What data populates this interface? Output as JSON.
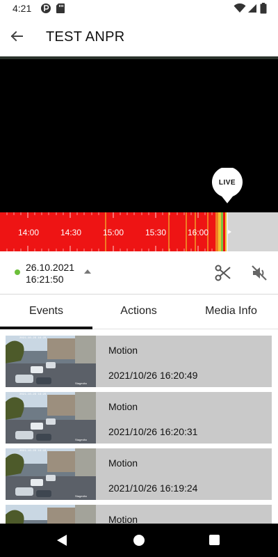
{
  "status_bar": {
    "time": "4:21",
    "left_icons": [
      "p-badge-icon",
      "sd-card-icon"
    ],
    "right_icons": [
      "wifi-icon",
      "signal-icon",
      "battery-icon"
    ]
  },
  "app_bar": {
    "back_icon": "arrow-back-icon",
    "title": "TEST ANPR"
  },
  "video": {
    "live_label": "LIVE"
  },
  "timeline": {
    "tick_labels": [
      "14:00",
      "14:30",
      "15:00",
      "15:30",
      "16:00"
    ],
    "colors": {
      "recorded": "#ee1414",
      "empty": "#d4d4d4",
      "event_marker": "#f2c230",
      "motion_marker": "#7ac043"
    }
  },
  "playback": {
    "date": "26.10.2021",
    "time": "16:21:50",
    "status_color": "#6cbf3a",
    "caret_icon": "caret-up-icon",
    "clip_icon": "scissors-icon",
    "mute_icon": "volume-off-icon"
  },
  "tabs": [
    {
      "label": "Events",
      "active": true
    },
    {
      "label": "Actions",
      "active": false
    },
    {
      "label": "Media Info",
      "active": false
    }
  ],
  "events": [
    {
      "type": "Motion",
      "timestamp": "2021/10/26 16:20:49"
    },
    {
      "type": "Motion",
      "timestamp": "2021/10/26 16:20:31"
    },
    {
      "type": "Motion",
      "timestamp": "2021/10/26 16:19:24"
    },
    {
      "type": "Motion",
      "timestamp": ""
    }
  ],
  "nav_bar": {
    "icons": [
      "nav-back-icon",
      "nav-home-icon",
      "nav-recents-icon"
    ]
  }
}
